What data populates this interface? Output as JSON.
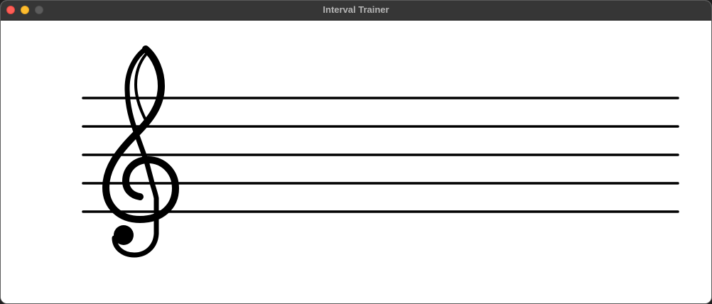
{
  "window": {
    "title": "Interval Trainer",
    "controls": {
      "close": "close-button",
      "minimize": "minimize-button",
      "zoom": "zoom-button"
    }
  },
  "staff": {
    "clef": "treble",
    "clef_icon": "treble-clef-icon",
    "line_count": 5,
    "notes": []
  },
  "colors": {
    "titlebar": "#363636",
    "title_text": "#b4b4b4",
    "close": "#fe5f57",
    "minimize": "#febc2e",
    "zoom": "#5c5c5c",
    "ink": "#000000",
    "canvas": "#ffffff"
  }
}
